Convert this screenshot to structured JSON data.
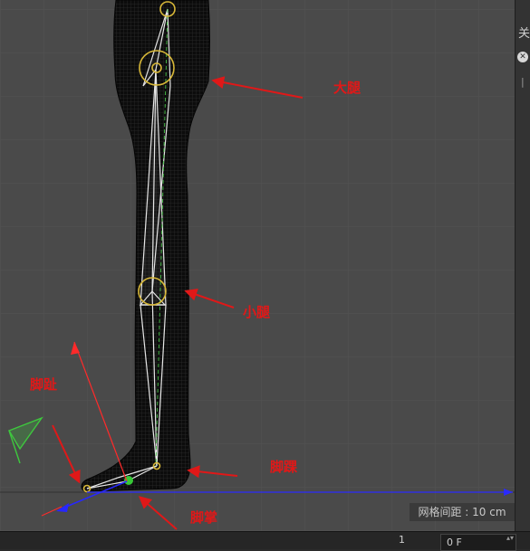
{
  "viewport": {
    "grid_spacing_label": "网格间距 : 10 cm"
  },
  "annotations": {
    "thigh": "大腿",
    "shin": "小腿",
    "toe": "脚趾",
    "ankle": "脚踝",
    "sole": "脚掌"
  },
  "side_panel": {
    "title_glyph": "关",
    "close_glyph": "✕",
    "edge_glyph": "|"
  },
  "timeline": {
    "frame_number": "1",
    "current_frame_value": "0 F",
    "spinner_glyph": "▴▾"
  },
  "colors": {
    "viewport_bg": "#4a4a4a",
    "grid_line": "#505050",
    "annotation_red": "#e01818",
    "bone_white": "#e8e8e8",
    "joint_yellow": "#d8b838",
    "axis_blue": "#2020ff",
    "axis_green": "#3ec83e",
    "axis_red": "#ff2a2a"
  }
}
